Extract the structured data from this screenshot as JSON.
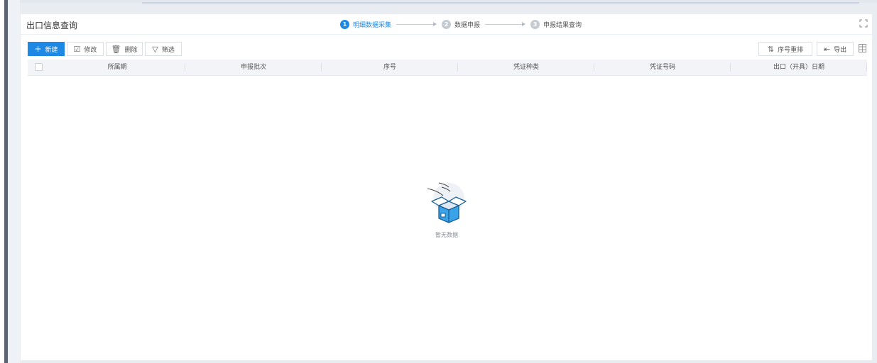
{
  "header": {
    "title": "出口信息查询",
    "steps": [
      {
        "num": "1",
        "label": "明细数据采集"
      },
      {
        "num": "2",
        "label": "数据申报"
      },
      {
        "num": "3",
        "label": "申报结果查询"
      }
    ]
  },
  "toolbar": {
    "new_label": "新建",
    "edit_label": "修改",
    "delete_label": "删除",
    "filter_label": "筛选",
    "reorder_label": "序号重排",
    "export_label": "导出"
  },
  "table": {
    "columns": [
      "所属期",
      "申报批次",
      "序号",
      "凭证种类",
      "凭证号码",
      "出口（开具）日期"
    ],
    "rows": []
  },
  "empty_state": {
    "text": "暂无数据"
  },
  "colors": {
    "accent": "#1e88e5",
    "header_bg": "#f2f4f7",
    "left_bar": "#5a6473"
  },
  "icons": {
    "new": "plus-icon",
    "edit": "edit-icon",
    "delete": "trash-icon",
    "filter": "funnel-icon",
    "reorder": "sort-icon",
    "export": "export-icon",
    "settings": "table-settings-icon",
    "fullscreen": "expand-icon",
    "empty": "empty-box-icon"
  }
}
